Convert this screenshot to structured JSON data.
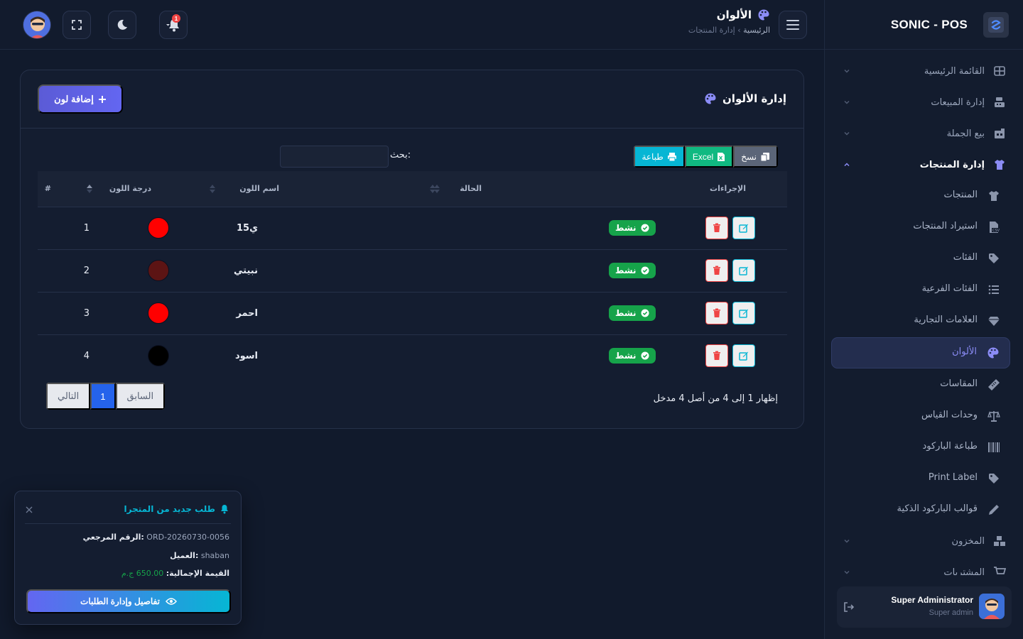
{
  "app": {
    "brand": "SONIC - POS"
  },
  "header": {
    "title": "الألوان",
    "breadcrumb_home": "الرئيسية",
    "breadcrumb_sep": "›",
    "breadcrumb_current": "إدارة المنتجات",
    "notifications_count": "1"
  },
  "sidebar": {
    "main": [
      {
        "label": "القائمة الرئيسية"
      },
      {
        "label": "إدارة المبيعات"
      },
      {
        "label": "بيع الجملة"
      },
      {
        "label": "إدارة المنتجات"
      }
    ],
    "sub": [
      {
        "label": "المنتجات"
      },
      {
        "label": "استيراد المنتجات"
      },
      {
        "label": "الفئات"
      },
      {
        "label": "الفئات الفرعية"
      },
      {
        "label": "العلامات التجارية"
      },
      {
        "label": "الألوان"
      },
      {
        "label": "المقاسات"
      },
      {
        "label": "وحدات القياس"
      },
      {
        "label": "طباعة الباركود"
      },
      {
        "label": "Print Label"
      },
      {
        "label": "قوالب الباركود الذكية"
      }
    ],
    "bottom": [
      {
        "label": "المخزون"
      },
      {
        "label": "المشتريات"
      }
    ],
    "user": {
      "name": "Super Administrator",
      "role": "Super admin"
    }
  },
  "card": {
    "title": "إدارة الألوان",
    "add_label": "إضافة لون",
    "tools": {
      "copy": "نسخ",
      "excel": "Excel",
      "print": "طباعة"
    },
    "search_label": "بحث:",
    "search_value": "",
    "columns": {
      "num": "#",
      "shade": "درجة اللون",
      "name": "اسم اللون",
      "status": "الحالة",
      "actions": "الإجراءات"
    },
    "rows": [
      {
        "num": "1",
        "color": "#ff0000",
        "name": "15ي",
        "status": "نشط"
      },
      {
        "num": "2",
        "color": "#5c1414",
        "name": "نبيتي",
        "status": "نشط"
      },
      {
        "num": "3",
        "color": "#ff0000",
        "name": "احمر",
        "status": "نشط"
      },
      {
        "num": "4",
        "color": "#000000",
        "name": "اسود",
        "status": "نشط"
      }
    ],
    "info": "إظهار 1 إلى 4 من أصل 4 مدخل",
    "pager": {
      "prev": "السابق",
      "current": "1",
      "next": "التالي"
    }
  },
  "toast": {
    "title": "طلب جديد من المتجرا",
    "ref_label": "الرقم المرجعي:",
    "ref_value": "ORD-20260730-0056",
    "customer_label": "العميل:",
    "customer_value": "shaban",
    "total_label": "القيمة الإجمالية:",
    "total_value": "650.00 ج.م",
    "button": "تفاصيل وإدارة الطلبات"
  },
  "colors": {
    "accent": "#6366f1",
    "active": "#16a34a",
    "danger": "#ef4444",
    "info": "#06b6d4"
  }
}
